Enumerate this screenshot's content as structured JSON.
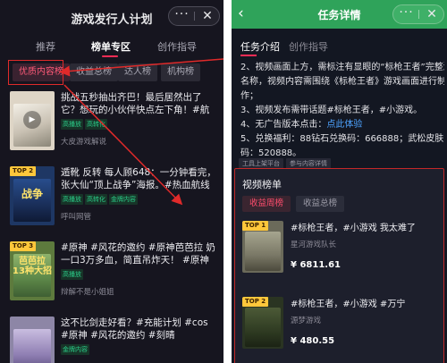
{
  "left": {
    "title": "游戏发行人计划",
    "capsule": {
      "more": "···",
      "close": "✕"
    },
    "tabs": [
      {
        "label": "推荐"
      },
      {
        "label": "榜单专区"
      },
      {
        "label": "创作指导"
      }
    ],
    "chips": [
      {
        "label": "优质内容榜"
      },
      {
        "label": "收益总榜"
      },
      {
        "label": "达人榜"
      },
      {
        "label": "机构榜"
      }
    ],
    "items": [
      {
        "badge": "",
        "title": "挑战五秒抽出齐巴！最后居然出了它？想玩的小伙伴快点左下角！#航海王热血...",
        "tags": [
          "高播放",
          "高转化"
        ],
        "author": "大皮游戏解说"
      },
      {
        "badge": "TOP 2",
        "thumb_text": "战争",
        "title": "遁靴 反转 每人顾648：一分钟看完，张大仙“顶上战争”海报。#热血航线鹰眼上线...",
        "tags": [
          "高播放",
          "高转化",
          "金牌内容"
        ],
        "author": "呼叫网管"
      },
      {
        "badge": "TOP 3",
        "thumb_text": "芭芭拉\n13种大招",
        "title": "#原神 #风花的邀约 #原神芭芭拉 奶一口3万多血，简直吊炸天！ #原神攻略 感谢...",
        "tags": [
          "高播放"
        ],
        "author": "辩解不是小姐姐"
      },
      {
        "badge": "",
        "title": "这不比剑走好看？#充能计划 #cos #原神 #风花的邀约 #刻晴",
        "tags": [
          "金牌内容"
        ],
        "author": ""
      }
    ]
  },
  "right": {
    "title": "任务详情",
    "back": "‹",
    "capsule": {
      "more": "···",
      "close": "✕"
    },
    "tabs": [
      {
        "label": "任务介绍"
      },
      {
        "label": "创作指导"
      }
    ],
    "lines": [
      "2、视频画面上方，需标注有显眼的“标枪王者”完整游戏",
      "名称，视频内容需围绕《标枪王者》游戏画面进行制",
      "作；",
      "3、视频发布需带话题#标枪王者，#小游戏。",
      "4、无广告版本点击：",
      "5、兑换福利：88钻石兑换码：666888；武松皮肤兑换",
      "码：520888。"
    ],
    "link_text": "点此体验",
    "chips": [
      "工具上架平台",
      "参与内容详情"
    ],
    "video_board": {
      "title": "视频榜单",
      "tabs": [
        "收益周榜",
        "收益总榜"
      ],
      "items": [
        {
          "badge": "TOP 1",
          "title": "#标枪王者，#小游戏 我太难了",
          "author": "星河游戏队长",
          "amount": "¥ 6811.61"
        },
        {
          "badge": "TOP 2",
          "title": "#标枪王者，#小游戏 #万宁",
          "author": "源梦游戏",
          "amount": "¥ 480.55"
        }
      ]
    }
  }
}
